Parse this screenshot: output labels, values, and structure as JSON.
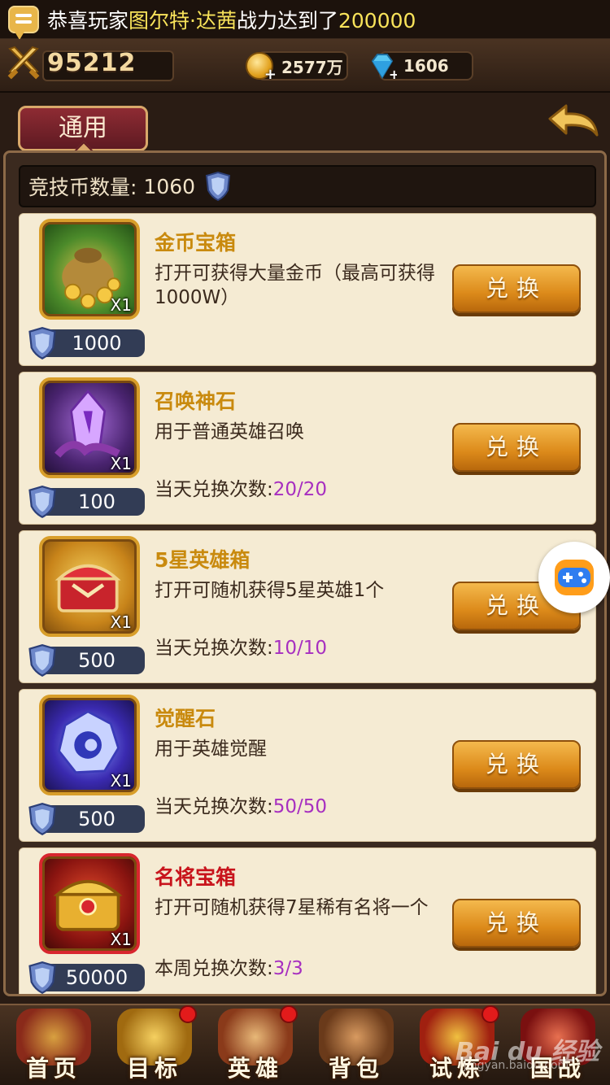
{
  "announcement": {
    "prefix": "恭喜玩家",
    "player": "图尔特·达茜",
    "middle": "战力达到了",
    "value": "200000"
  },
  "resources": {
    "power": "95212",
    "gold": "2577万",
    "diamond": "1606"
  },
  "tabs": {
    "general": "通用"
  },
  "currency": {
    "label": "竞技币数量:",
    "amount": "1060"
  },
  "items": [
    {
      "name": "金币宝箱",
      "desc": "打开可获得大量金币（最高可获得1000W）",
      "limit_label": "",
      "limit": "",
      "qty": "X1",
      "price": "1000",
      "button": "兑换",
      "name_color": "gold"
    },
    {
      "name": "召唤神石",
      "desc": "用于普通英雄召唤",
      "limit_label": "当天兑换次数:",
      "limit": "20/20",
      "qty": "X1",
      "price": "100",
      "button": "兑换",
      "name_color": "gold"
    },
    {
      "name": "5星英雄箱",
      "desc": "打开可随机获得5星英雄1个",
      "limit_label": "当天兑换次数:",
      "limit": "10/10",
      "qty": "X1",
      "price": "500",
      "button": "兑换",
      "name_color": "gold"
    },
    {
      "name": "觉醒石",
      "desc": "用于英雄觉醒",
      "limit_label": "当天兑换次数:",
      "limit": "50/50",
      "qty": "X1",
      "price": "500",
      "button": "兑换",
      "name_color": "gold"
    },
    {
      "name": "名将宝箱",
      "desc": "打开可随机获得7星稀有名将一个",
      "limit_label": "本周兑换次数:",
      "limit": "3/3",
      "qty": "X1",
      "price": "50000",
      "button": "兑换",
      "name_color": "red"
    }
  ],
  "nav": [
    {
      "label": "首页",
      "icon": "home-icon",
      "badge": false
    },
    {
      "label": "目标",
      "icon": "crown-icon",
      "badge": true
    },
    {
      "label": "英雄",
      "icon": "hero-icon",
      "badge": true
    },
    {
      "label": "背包",
      "icon": "backpack-icon",
      "badge": false
    },
    {
      "label": "试炼",
      "icon": "trial-icon",
      "badge": true
    },
    {
      "label": "国战",
      "icon": "war-icon",
      "badge": false
    }
  ],
  "watermark": {
    "brand": "Bai du 经验",
    "url": "jingyan.baidu.com"
  },
  "colors": {
    "accent": "#dc8a1a",
    "limit": "#a72fc0",
    "name_gold": "#c98a0e",
    "name_red": "#c8141c"
  }
}
